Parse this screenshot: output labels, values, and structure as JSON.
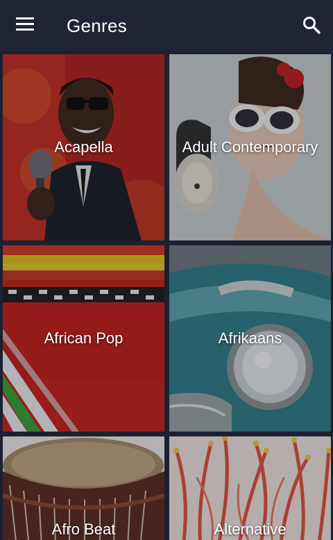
{
  "app_bar": {
    "title": "Genres",
    "menu_icon": "hamburger-menu-icon",
    "search_icon": "search-icon",
    "background": "#1f2536"
  },
  "genres": [
    {
      "label": "Acapella"
    },
    {
      "label": "Adult Contemporary"
    },
    {
      "label": "African Pop"
    },
    {
      "label": "Afrikaans"
    },
    {
      "label": "Afro Beat"
    },
    {
      "label": "Alternative"
    }
  ]
}
